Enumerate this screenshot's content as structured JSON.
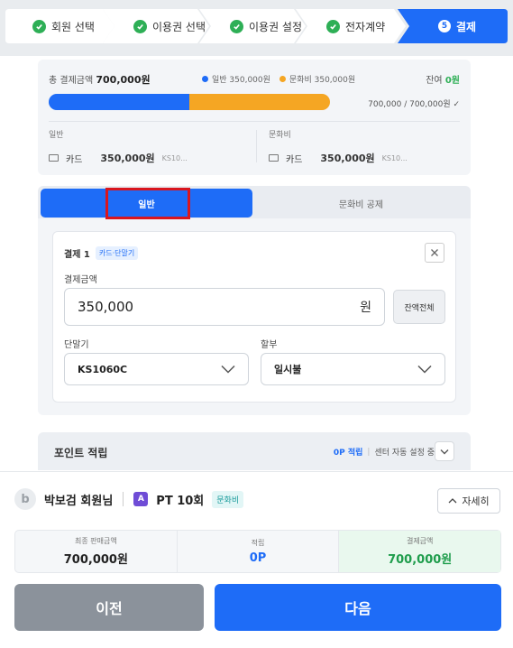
{
  "stepper": {
    "steps": [
      {
        "label": "회원 선택",
        "state": "done"
      },
      {
        "label": "이용권 선택",
        "state": "done"
      },
      {
        "label": "이용권 설정",
        "state": "done"
      },
      {
        "label": "전자계약",
        "state": "done"
      },
      {
        "label": "결제",
        "state": "active",
        "number": "5"
      }
    ]
  },
  "summary": {
    "total_label": "총 결제금액",
    "total_amount": "700,000원",
    "legend_general": "일반 350,000원",
    "legend_culture": "문화비 350,000원",
    "remain_label": "잔여",
    "remain_value": "0원",
    "progress_general_share": 0.5,
    "progress_culture_share": 0.5,
    "ratio_text": "700,000 / 700,000원 ✓",
    "general": {
      "title": "일반",
      "method": "카드",
      "amount": "350,000원",
      "device": "KS10..."
    },
    "culture": {
      "title": "문화비",
      "method": "카드",
      "amount": "350,000원",
      "device": "KS10..."
    }
  },
  "payment": {
    "tabs": {
      "general": "일반",
      "culture": "문화비 공제"
    },
    "card_title": "결제 1",
    "card_tag": "카드·단말기",
    "amount_label": "결제금액",
    "amount_value": "350,000",
    "amount_unit": "원",
    "fill_button": "잔액전체",
    "terminal_label": "단말기",
    "terminal_value": "KS1060C",
    "installment_label": "할부",
    "installment_value": "일시불"
  },
  "points": {
    "title": "포인트 적립",
    "value": "0P 적립",
    "mode": "센터 자동 설정 중"
  },
  "bottom": {
    "avatar_letter": "b",
    "member_name": "박보검 회원님",
    "pass_letter": "A",
    "pass_name": "PT 10회",
    "pass_tag": "문화비",
    "detail_button": "자세히",
    "final_label": "최종 판매금액",
    "final_value": "700,000원",
    "point_label": "적립",
    "point_value": "0P",
    "pay_label": "결제금액",
    "pay_value": "700,000원",
    "prev_button": "이전",
    "next_button": "다음"
  },
  "colors": {
    "primary": "#1e6cf7",
    "general_bar": "#1e6cf7",
    "culture_bar": "#f5a623",
    "success": "#2eaf56",
    "highlight_box": "#d9161e"
  }
}
